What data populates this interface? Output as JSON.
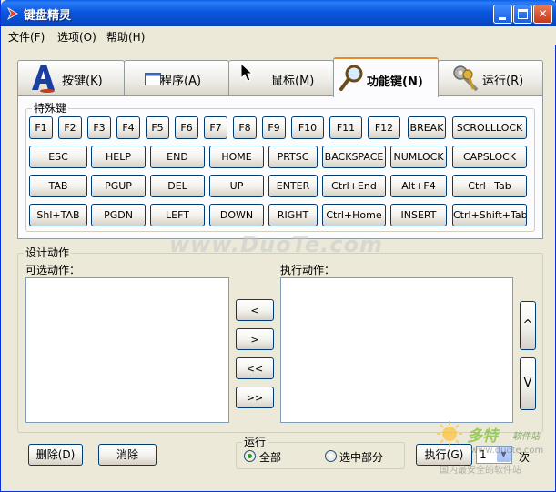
{
  "window": {
    "title": "键盘精灵"
  },
  "menu": [
    "文件(F)",
    "选项(O)",
    "帮助(H)"
  ],
  "tabs": [
    {
      "label": "按键(K)",
      "icon": "letter-a-icon"
    },
    {
      "label": "程序(A)",
      "icon": "window-icon"
    },
    {
      "label": "鼠标(M)",
      "icon": "mouse-pointer-icon"
    },
    {
      "label": "功能键(N)",
      "icon": "magnifier-icon",
      "active": true
    },
    {
      "label": "运行(R)",
      "icon": "keys-icon"
    }
  ],
  "special_keys": {
    "title": "特殊键",
    "row1": [
      "F1",
      "F2",
      "F3",
      "F4",
      "F5",
      "F6",
      "F7",
      "F8",
      "F9",
      "F10",
      "F11",
      "F12",
      "BREAK",
      "SCROLLLOCK"
    ],
    "row2": [
      "ESC",
      "HELP",
      "END",
      "HOME",
      "PRTSC",
      "BACKSPACE",
      "NUMLOCK",
      "CAPSLOCK"
    ],
    "row3": [
      "TAB",
      "PGUP",
      "DEL",
      "UP",
      "ENTER",
      "Ctrl+End",
      "Alt+F4",
      "Ctrl+Tab"
    ],
    "row4": [
      "Shl+TAB",
      "PGDN",
      "LEFT",
      "DOWN",
      "RIGHT",
      "Ctrl+Home",
      "INSERT",
      "Ctrl+Shift+Tab"
    ]
  },
  "design": {
    "title": "设计动作",
    "available_label": "可选动作：",
    "executed_label": "执行动作：",
    "move_buttons": [
      "<",
      ">",
      "<<",
      ">>"
    ],
    "order_buttons": [
      "^",
      "V"
    ]
  },
  "bottom": {
    "delete_label": "删除(D)",
    "clear_label": "消除",
    "run_group_title": "运行",
    "radio_all": "全部",
    "radio_selected": "选中部分",
    "execute_label": "执行(G)",
    "times_value": "1",
    "times_unit": "次"
  },
  "watermark": {
    "main": "www.DuoTe.com",
    "logo_text": "多特",
    "logo_sub": "软件站",
    "site": "www.duote.com",
    "slogan": "国内最安全的软件站"
  }
}
